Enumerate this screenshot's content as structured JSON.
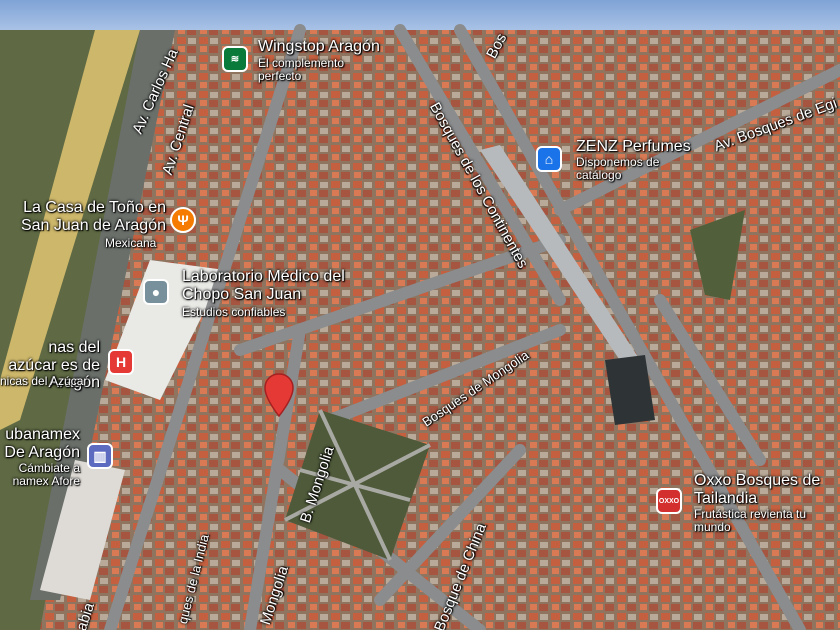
{
  "map": {
    "streets": {
      "carlos_h": "Av. Carlos Ha",
      "central": "Av. Central",
      "bosques_continentes": "Bosques de los Continentes",
      "bosques_egip": "Av. Bosques de Egi",
      "bosques_mongolia": "Bosques de Mongolia",
      "b_mongolia": "B. Mongolia",
      "mongolia": "Mongolia",
      "bosque_china": "Bosque de China",
      "bosques_india": "ques de la India",
      "bos_top": "Bos",
      "abia": "abia"
    },
    "pois": [
      {
        "name": "Wingstop Aragón",
        "sub": "El complemento perfecto",
        "icon": "wingstop-logo-icon"
      },
      {
        "name": "ZENZ Perfumes",
        "sub": "Disponemos de catálogo",
        "icon": "shopping-bag-icon"
      },
      {
        "name": "La Casa de Toño en San Juan de Aragón",
        "sub": "Mexicana",
        "icon": "restaurant-icon"
      },
      {
        "name": "Laboratorio Médico del Chopo San Juan",
        "sub": "Estudios confiables",
        "icon": "laboratory-icon"
      },
      {
        "name": "nas del azúcar es de Aragón",
        "sub": "nicas del Azúcar",
        "icon": "hospital-icon"
      },
      {
        "name": "ubanamex De Aragón",
        "sub": "Cámbiate a namex Afore",
        "icon": "bank-icon"
      },
      {
        "name": "Oxxo Bosques de Tailandia",
        "sub": "Frutástica revienta tu mundo",
        "icon": "oxxo-logo-icon"
      }
    ],
    "pin_letters": {
      "hospital": "H",
      "oxxo": "OXXO"
    },
    "colors": {
      "pin_red": "#e53935",
      "restaurant": "#f57c00",
      "shopping": "#1a73e8",
      "lab": "#78909c",
      "bank": "#5c6bc0",
      "wingstop": "#0a7a3b"
    }
  }
}
